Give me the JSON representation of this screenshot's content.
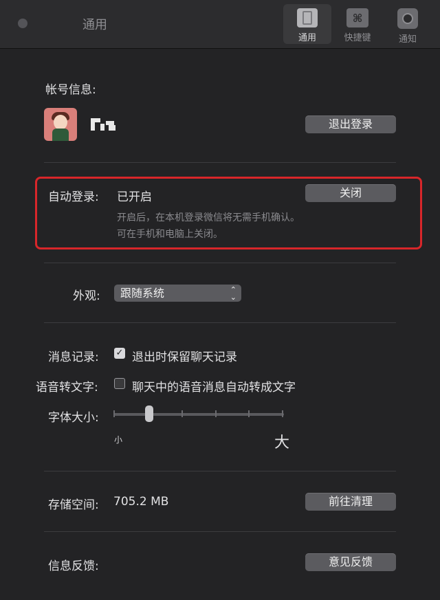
{
  "window": {
    "title": "通用"
  },
  "toolbar": {
    "tabs": [
      {
        "label": "通用",
        "icon": "general-switch-icon",
        "active": true
      },
      {
        "label": "快捷键",
        "icon": "command-key-icon",
        "active": false
      },
      {
        "label": "通知",
        "icon": "notification-icon",
        "active": false
      }
    ],
    "command_glyph": "⌘"
  },
  "account": {
    "label": "帐号信息:",
    "logout_label": "退出登录"
  },
  "auto_login": {
    "label": "自动登录:",
    "status": "已开启",
    "close_label": "关闭",
    "description_line1": "开启后，在本机登录微信将无需手机确认。",
    "description_line2": "可在手机和电脑上关闭。",
    "highlight_color": "#d8262a"
  },
  "appearance": {
    "label": "外观:",
    "selected": "跟随系统",
    "arrows": "⌃⌄"
  },
  "message_record": {
    "label": "消息记录:",
    "option": "退出时保留聊天记录",
    "checked": true,
    "check_glyph": "✓"
  },
  "voice_to_text": {
    "label": "语音转文字:",
    "option": "聊天中的语音消息自动转成文字",
    "checked": false
  },
  "font_size": {
    "label": "字体大小:",
    "small_label": "小",
    "large_label": "大",
    "level": 2,
    "levels": 6
  },
  "storage": {
    "label": "存储空间:",
    "value": "705.2 MB",
    "clean_label": "前往清理"
  },
  "feedback": {
    "label": "信息反馈:",
    "button_label": "意见反馈"
  }
}
